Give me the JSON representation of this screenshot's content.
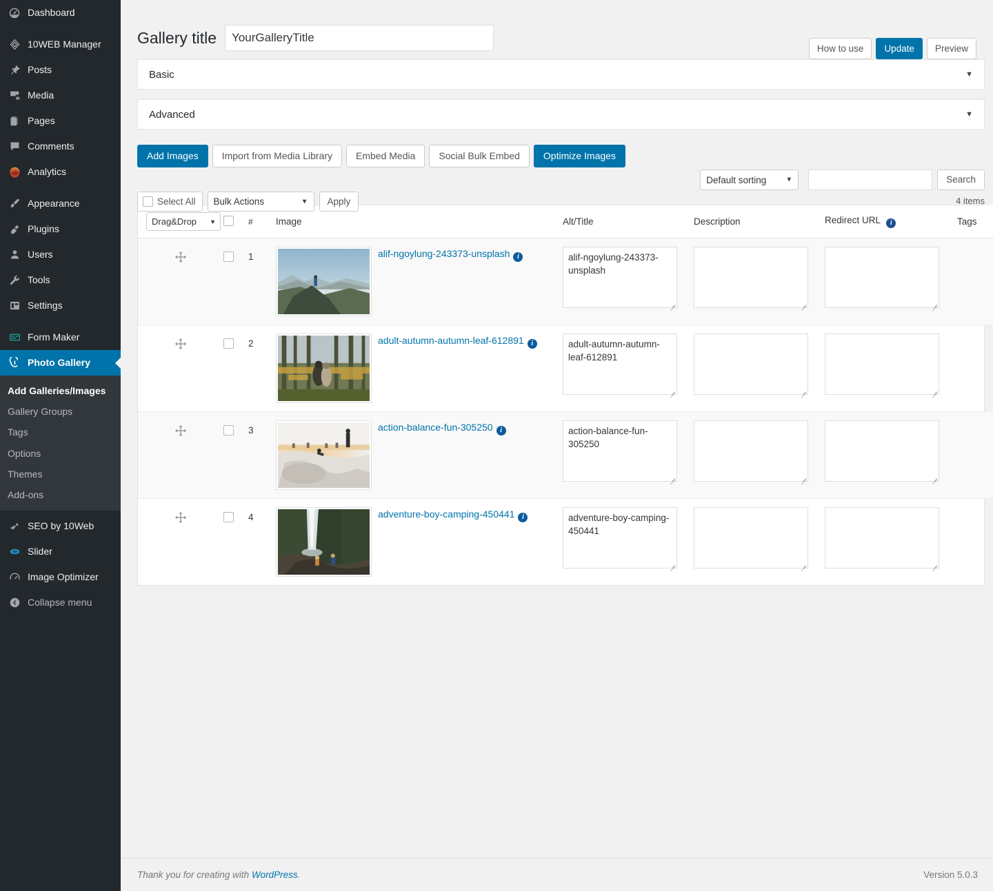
{
  "sidebar": {
    "items": [
      {
        "label": "Dashboard",
        "icon": "dashboard-icon",
        "name": "dashboard"
      },
      {
        "label": "10WEB Manager",
        "icon": "tenweb-icon",
        "name": "10web-manager"
      },
      {
        "label": "Posts",
        "icon": "pin-icon",
        "name": "posts"
      },
      {
        "label": "Media",
        "icon": "media-icon",
        "name": "media"
      },
      {
        "label": "Pages",
        "icon": "pages-icon",
        "name": "pages"
      },
      {
        "label": "Comments",
        "icon": "comments-icon",
        "name": "comments"
      },
      {
        "label": "Analytics",
        "icon": "analytics-icon",
        "name": "analytics"
      },
      {
        "label": "Appearance",
        "icon": "brush-icon",
        "name": "appearance"
      },
      {
        "label": "Plugins",
        "icon": "plug-icon",
        "name": "plugins"
      },
      {
        "label": "Users",
        "icon": "user-icon",
        "name": "users"
      },
      {
        "label": "Tools",
        "icon": "wrench-icon",
        "name": "tools"
      },
      {
        "label": "Settings",
        "icon": "settings-icon",
        "name": "settings"
      },
      {
        "label": "Form Maker",
        "icon": "form-maker-icon",
        "name": "form-maker"
      },
      {
        "label": "Photo Gallery",
        "icon": "photo-gallery-icon",
        "name": "photo-gallery"
      }
    ],
    "submenu": [
      {
        "label": "Add Galleries/Images",
        "current": true
      },
      {
        "label": "Gallery Groups",
        "current": false
      },
      {
        "label": "Tags",
        "current": false
      },
      {
        "label": "Options",
        "current": false
      },
      {
        "label": "Themes",
        "current": false
      },
      {
        "label": "Add-ons",
        "current": false
      }
    ],
    "bottom_items": [
      {
        "label": "SEO by 10Web",
        "icon": "seo-icon",
        "name": "seo-by-10web"
      },
      {
        "label": "Slider",
        "icon": "slider-icon",
        "name": "slider"
      },
      {
        "label": "Image Optimizer",
        "icon": "gauge-icon",
        "name": "image-optimizer"
      }
    ],
    "collapse_label": "Collapse menu",
    "active_color": "#0073aa"
  },
  "header": {
    "title_label": "Gallery title",
    "title_value": "YourGalleryTitle",
    "title_placeholder": "Gallery title",
    "buttons": {
      "how_to_use": "How to use",
      "update": "Update",
      "preview": "Preview"
    }
  },
  "panels": [
    {
      "label": "Basic",
      "expanded": false
    },
    {
      "label": "Advanced",
      "expanded": false
    }
  ],
  "toolbar": {
    "add_images": "Add Images",
    "import_media_library": "Import from Media Library",
    "embed_media": "Embed Media",
    "social_bulk_embed": "Social Bulk Embed",
    "optimize_images": "Optimize Images"
  },
  "filters": {
    "select_all": "Select All",
    "bulk_actions": "Bulk Actions",
    "apply": "Apply",
    "sorting": "Default sorting",
    "search_value": "",
    "search_placeholder": "",
    "search_button": "Search",
    "items_count": "4 items"
  },
  "table": {
    "headers": {
      "drag_drop": "Drag&Drop",
      "num": "#",
      "image": "Image",
      "alt_title": "Alt/Title",
      "description": "Description",
      "redirect_url": "Redirect URL",
      "tags": "Tags"
    },
    "rows": [
      {
        "num": "1",
        "filename": "alif-ngoylung-243373-unsplash",
        "alt": "alif-ngoylung-243373-unsplash",
        "description": "",
        "redirect_url": "",
        "tags": "",
        "thumb": "mountain-fog-photographer"
      },
      {
        "num": "2",
        "filename": "adult-autumn-autumn-leaf-612891",
        "alt": "adult-autumn-autumn-leaf-612891",
        "description": "",
        "redirect_url": "",
        "tags": "",
        "thumb": "autumn-forest-couple"
      },
      {
        "num": "3",
        "filename": "action-balance-fun-305250",
        "alt": "action-balance-fun-305250",
        "description": "",
        "redirect_url": "",
        "tags": "",
        "thumb": "skatepark-sunset"
      },
      {
        "num": "4",
        "filename": "adventure-boy-camping-450441",
        "alt": "adventure-boy-camping-450441",
        "description": "",
        "redirect_url": "",
        "tags": "",
        "thumb": "waterfall-rocks"
      }
    ]
  },
  "footer": {
    "thanks_prefix": "Thank you for creating with ",
    "wordpress_link": "WordPress",
    "thanks_suffix": ".",
    "version": "Version 5.0.3"
  }
}
